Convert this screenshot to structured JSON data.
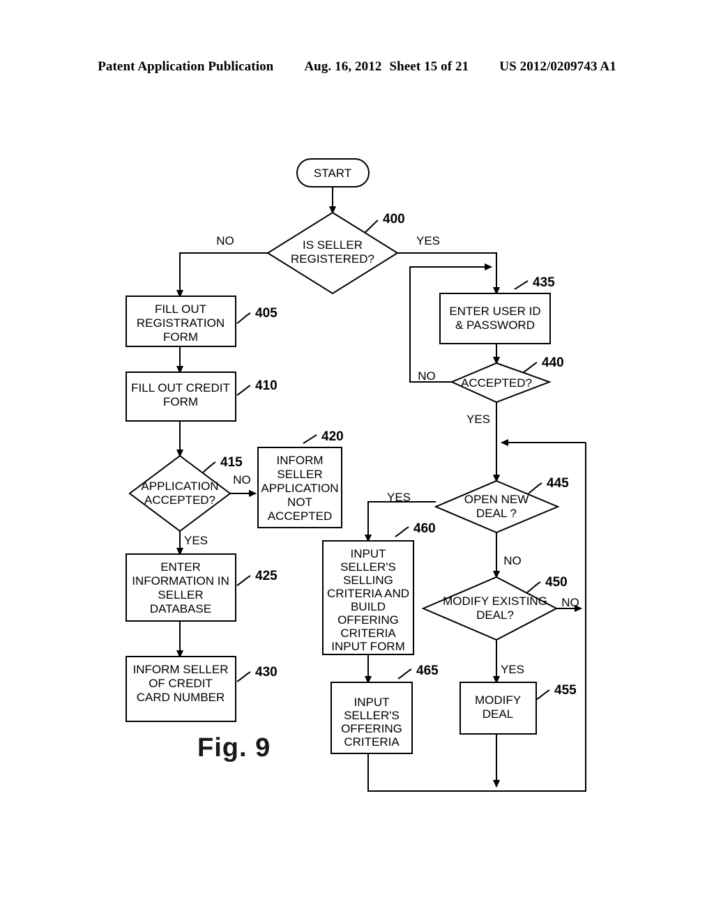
{
  "header": {
    "publication": "Patent Application Publication",
    "date": "Aug. 16, 2012",
    "sheet": "Sheet 15 of 21",
    "doc_number": "US 2012/0209743 A1"
  },
  "figure": {
    "caption": "Fig. 9"
  },
  "diagram": {
    "type": "flowchart",
    "terminal": {
      "label": "START"
    },
    "nodes": [
      {
        "ref": "400",
        "shape": "decision",
        "label_lines": [
          "IS SELLER",
          "REGISTERED?"
        ]
      },
      {
        "ref": "405",
        "shape": "process",
        "label_lines": [
          "FILL OUT",
          "REGISTRATION",
          "FORM"
        ]
      },
      {
        "ref": "410",
        "shape": "process",
        "label_lines": [
          "FILL OUT CREDIT",
          "FORM"
        ]
      },
      {
        "ref": "415",
        "shape": "decision",
        "label_lines": [
          "APPLICATION",
          "ACCEPTED?"
        ]
      },
      {
        "ref": "420",
        "shape": "process",
        "label_lines": [
          "INFORM",
          "SELLER",
          "APPLICATION",
          "NOT",
          "ACCEPTED"
        ]
      },
      {
        "ref": "425",
        "shape": "process",
        "label_lines": [
          "ENTER",
          "INFORMATION IN",
          "SELLER",
          "DATABASE"
        ]
      },
      {
        "ref": "430",
        "shape": "process",
        "label_lines": [
          "INFORM SELLER",
          "OF  CREDIT",
          "CARD NUMBER"
        ]
      },
      {
        "ref": "435",
        "shape": "process",
        "label_lines": [
          "ENTER USER ID",
          "& PASSWORD"
        ]
      },
      {
        "ref": "440",
        "shape": "decision",
        "label_lines": [
          "ACCEPTED?"
        ]
      },
      {
        "ref": "445",
        "shape": "decision",
        "label_lines": [
          "OPEN NEW",
          "DEAL ?"
        ]
      },
      {
        "ref": "450",
        "shape": "decision",
        "label_lines": [
          "MODIFY EXISTING",
          "DEAL?"
        ]
      },
      {
        "ref": "455",
        "shape": "process",
        "label_lines": [
          "MODIFY",
          "DEAL"
        ]
      },
      {
        "ref": "460",
        "shape": "process",
        "label_lines": [
          "INPUT",
          "SELLER'S",
          "SELLING",
          "CRITERIA AND",
          "BUILD",
          "OFFERING",
          "CRITERIA",
          "INPUT FORM"
        ]
      },
      {
        "ref": "465",
        "shape": "process",
        "label_lines": [
          "INPUT",
          "SELLER'S",
          "OFFERING",
          "CRITERIA"
        ]
      }
    ],
    "branch_labels": {
      "n400_no": "NO",
      "n400_yes": "YES",
      "n415_no": "NO",
      "n415_yes": "YES",
      "n440_no": "NO",
      "n440_yes": "YES",
      "n445_yes": "YES",
      "n445_no": "NO",
      "n450_no": "NO",
      "n450_yes": "YES"
    }
  }
}
